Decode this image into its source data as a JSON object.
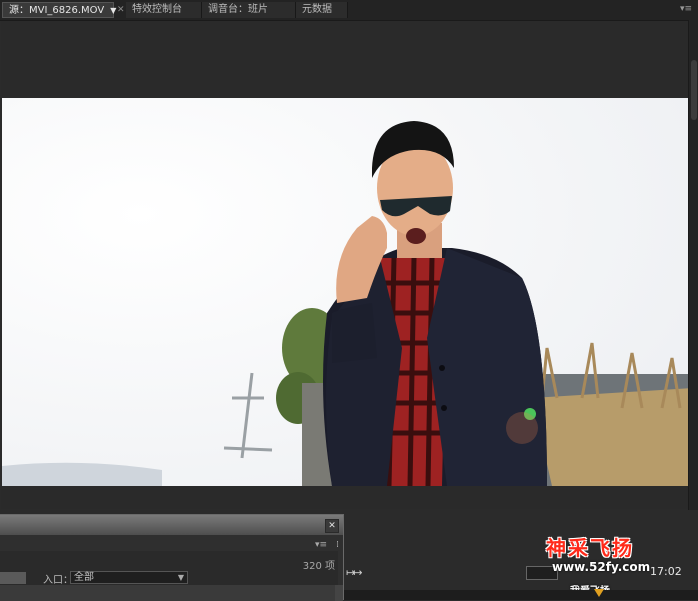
{
  "tabs": [
    {
      "label": "源：MVI_6826.MOV"
    },
    {
      "label": "特效控制台"
    },
    {
      "label": "调音台：班片"
    },
    {
      "label": "元数据"
    }
  ],
  "panel": {
    "count": "320 项",
    "in_label": "入口：",
    "in_value": "全部"
  },
  "watermark": {
    "title": "神采飞扬",
    "url": "www.52fy.com",
    "sub": "我爱飞扬"
  },
  "timecode": "17:02",
  "colors": {
    "background": "#2b2b2b",
    "frame": "#fdfdfd",
    "watermark": "#ff2a1a"
  }
}
